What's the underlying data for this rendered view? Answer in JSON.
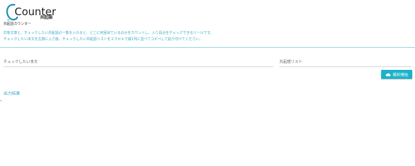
{
  "app": {
    "logo_text": "Counter",
    "logo_tag": "共起語",
    "subtitle": "共起語カウンター",
    "description": [
      "対象文章と、チェックしたい共起語の一覧を入れると、どこに何回出ているのかをカウントし、入り具合をチェックできるツールです。",
      "チェックしたい本文を左側に入力後、チェックしたい共起語リストをエクセルで縦1列に並べてコピペして貼り付けてください。"
    ]
  },
  "form": {
    "check_text_placeholder": "チェックしたい本文",
    "cooccurrence_list_placeholder": "共起語リスト",
    "run_button_label": "解析開始"
  },
  "result": {
    "title": "出力結果"
  },
  "colors": {
    "accent": "#1ab3cb",
    "text_accent": "#3aa7c8"
  },
  "icons": {
    "run_button_icon": "cloud-icon"
  }
}
